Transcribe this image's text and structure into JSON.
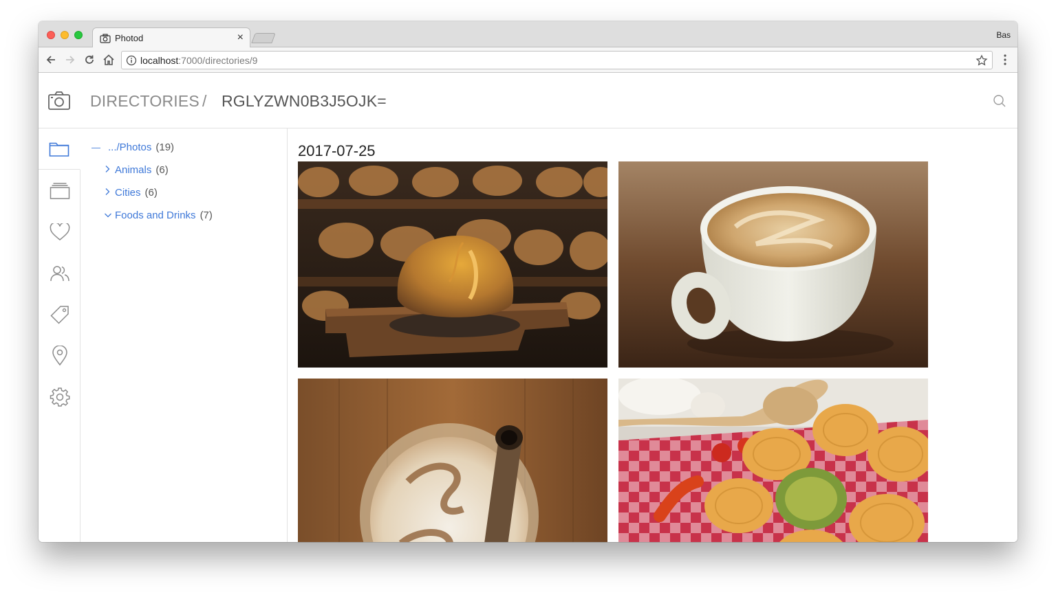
{
  "browser": {
    "tab_title": "Photod",
    "profile_name": "Bas",
    "url_host": "localhost",
    "url_path": ":7000/directories/9"
  },
  "app": {
    "breadcrumb_root": "DIRECTORIES",
    "breadcrumb_separator": "/",
    "breadcrumb_current": "RGLYZWN0B3J5OJK="
  },
  "sidebar": {
    "items": [
      {
        "icon": "folder-icon",
        "active": true
      },
      {
        "icon": "albums-icon",
        "active": false
      },
      {
        "icon": "heart-icon",
        "active": false
      },
      {
        "icon": "people-icon",
        "active": false
      },
      {
        "icon": "tag-icon",
        "active": false
      },
      {
        "icon": "location-pin-icon",
        "active": false
      },
      {
        "icon": "gear-icon",
        "active": false
      }
    ]
  },
  "tree": {
    "root": {
      "toggle": "—",
      "label": ".../Photos",
      "count": "(19)"
    },
    "children": [
      {
        "toggle": ">",
        "label": "Animals",
        "count": "(6)",
        "expanded": false
      },
      {
        "toggle": ">",
        "label": "Cities",
        "count": "(6)",
        "expanded": false
      },
      {
        "toggle": "v",
        "label": "Foods and Drinks",
        "count": "(7)",
        "expanded": true
      }
    ]
  },
  "gallery": {
    "date": "2017-07-25",
    "photos": [
      {
        "subject": "bread loaf on wooden peel"
      },
      {
        "subject": "cappuccino cup"
      },
      {
        "subject": "iced coffee with straw"
      },
      {
        "subject": "pasta nests with vegetables"
      }
    ]
  },
  "colors": {
    "link": "#3e78d8",
    "rail_active": "#3e78d8",
    "icon_gray": "#8a8a8a"
  }
}
